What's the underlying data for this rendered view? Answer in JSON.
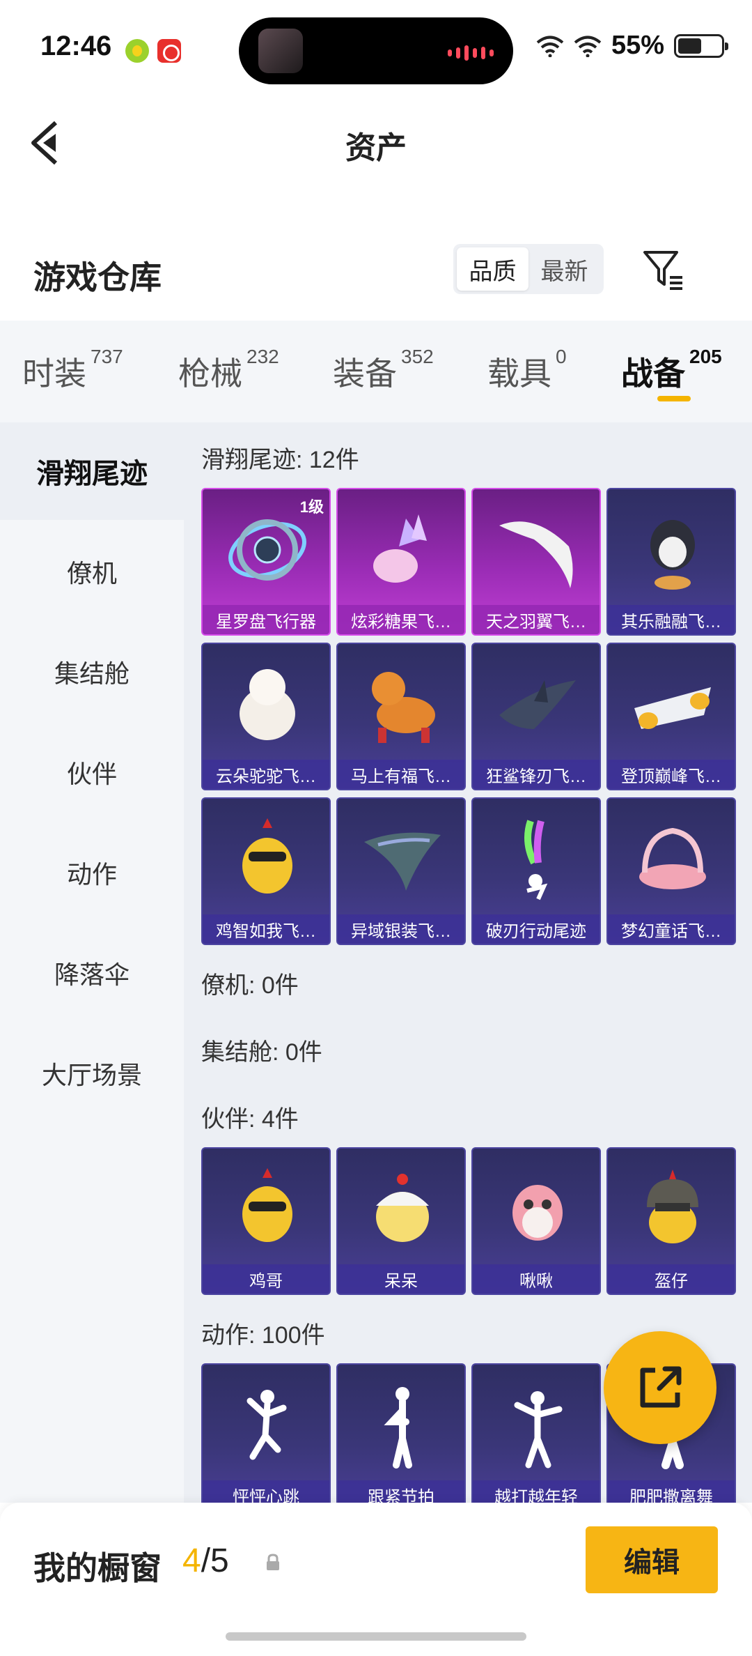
{
  "status": {
    "time": "12:46",
    "battery_pct": "55%",
    "battery_level": 0.55
  },
  "header": {
    "title": "资产"
  },
  "warehouse": {
    "title": "游戏仓库",
    "sort_options": [
      "品质",
      "最新"
    ],
    "active_sort": "品质"
  },
  "tabs": [
    {
      "label": "时装",
      "count": "737"
    },
    {
      "label": "枪械",
      "count": "232"
    },
    {
      "label": "装备",
      "count": "352"
    },
    {
      "label": "载具",
      "count": "0"
    },
    {
      "label": "战备",
      "count": "205",
      "active": true
    }
  ],
  "sidebar": {
    "items": [
      "滑翔尾迹",
      "僚机",
      "集结舱",
      "伙伴",
      "动作",
      "降落伞",
      "大厅场景"
    ],
    "active": "滑翔尾迹"
  },
  "sections": {
    "glide": {
      "title": "滑翔尾迹: 12件",
      "items": [
        {
          "name": "星罗盘飞行器",
          "level": "1级"
        },
        {
          "name": "炫彩糖果飞…"
        },
        {
          "name": "天之羽翼飞…"
        },
        {
          "name": "其乐融融飞…"
        },
        {
          "name": "云朵驼驼飞…"
        },
        {
          "name": "马上有福飞…"
        },
        {
          "name": "狂鲨锋刃飞…"
        },
        {
          "name": "登顶巅峰飞…"
        },
        {
          "name": "鸡智如我飞…"
        },
        {
          "name": "异域银装飞…"
        },
        {
          "name": "破刃行动尾迹"
        },
        {
          "name": "梦幻童话飞…"
        }
      ]
    },
    "wingman": {
      "title": "僚机: 0件"
    },
    "pod": {
      "title": "集结舱: 0件"
    },
    "partner": {
      "title": "伙伴: 4件",
      "items": [
        {
          "name": "鸡哥"
        },
        {
          "name": "呆呆"
        },
        {
          "name": "啾啾"
        },
        {
          "name": "盔仔"
        }
      ]
    },
    "emote": {
      "title": "动作: 100件",
      "items": [
        {
          "name": "怦怦心跳"
        },
        {
          "name": "跟紧节拍"
        },
        {
          "name": "越打越年轻"
        },
        {
          "name": "肥肥撒离舞"
        }
      ]
    }
  },
  "showcase": {
    "title": "我的橱窗",
    "current": "4",
    "total": "/5",
    "edit_label": "编辑"
  },
  "colors": {
    "accent": "#f4b400",
    "card_blue": "#3a3678",
    "card_purple": "#9a2cb5"
  }
}
